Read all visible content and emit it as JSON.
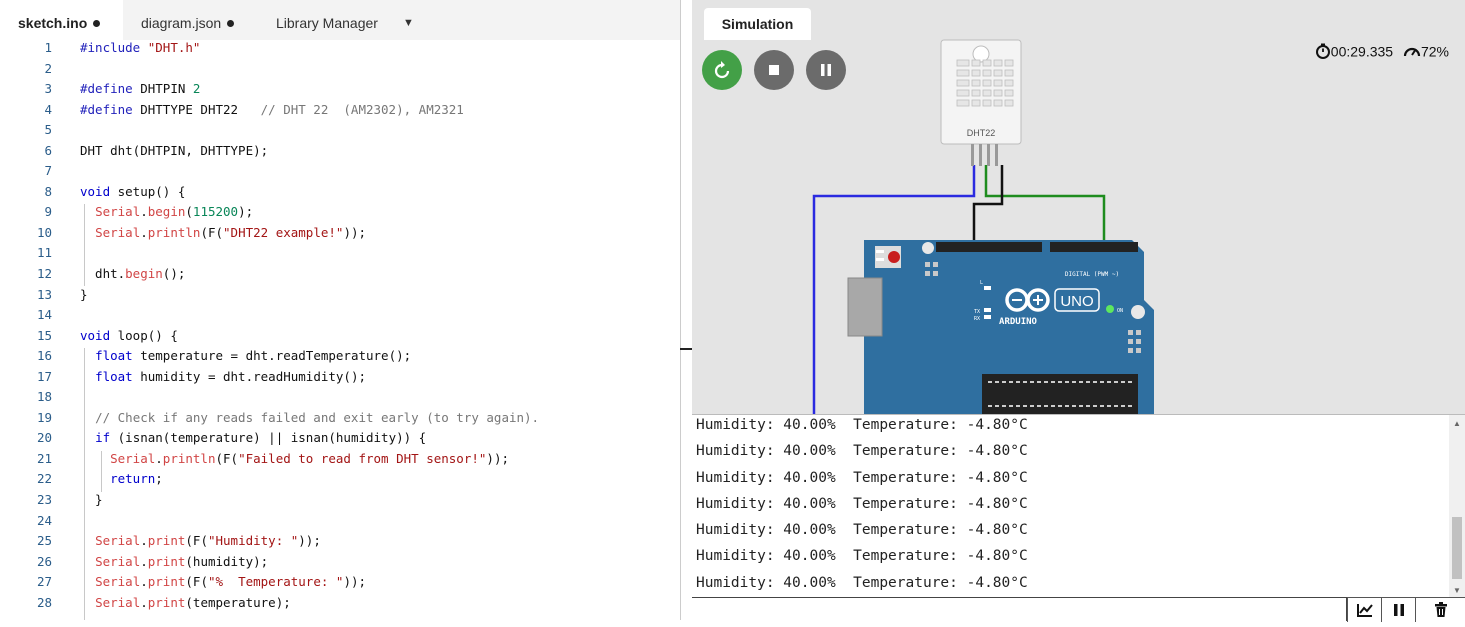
{
  "tabs": [
    {
      "label": "sketch.ino",
      "modified": true,
      "active": true
    },
    {
      "label": "diagram.json",
      "modified": true,
      "active": false
    },
    {
      "label": "Library Manager",
      "modified": false,
      "active": false
    }
  ],
  "code_lines": [
    {
      "n": "1",
      "text": "#include \"DHT.h\""
    },
    {
      "n": "2",
      "text": ""
    },
    {
      "n": "3",
      "text": "#define DHTPIN 2"
    },
    {
      "n": "4",
      "text": "#define DHTTYPE DHT22   // DHT 22  (AM2302), AM2321"
    },
    {
      "n": "5",
      "text": ""
    },
    {
      "n": "6",
      "text": "DHT dht(DHTPIN, DHTTYPE);"
    },
    {
      "n": "7",
      "text": ""
    },
    {
      "n": "8",
      "text": "void setup() {"
    },
    {
      "n": "9",
      "text": "  Serial.begin(115200);"
    },
    {
      "n": "10",
      "text": "  Serial.println(F(\"DHT22 example!\"));"
    },
    {
      "n": "11",
      "text": ""
    },
    {
      "n": "12",
      "text": "  dht.begin();"
    },
    {
      "n": "13",
      "text": "}"
    },
    {
      "n": "14",
      "text": ""
    },
    {
      "n": "15",
      "text": "void loop() {"
    },
    {
      "n": "16",
      "text": "  float temperature = dht.readTemperature();"
    },
    {
      "n": "17",
      "text": "  float humidity = dht.readHumidity();"
    },
    {
      "n": "18",
      "text": ""
    },
    {
      "n": "19",
      "text": "  // Check if any reads failed and exit early (to try again)."
    },
    {
      "n": "20",
      "text": "  if (isnan(temperature) || isnan(humidity)) {"
    },
    {
      "n": "21",
      "text": "    Serial.println(F(\"Failed to read from DHT sensor!\"));"
    },
    {
      "n": "22",
      "text": "    return;"
    },
    {
      "n": "23",
      "text": "  }"
    },
    {
      "n": "24",
      "text": ""
    },
    {
      "n": "25",
      "text": "  Serial.print(F(\"Humidity: \"));"
    },
    {
      "n": "26",
      "text": "  Serial.print(humidity);"
    },
    {
      "n": "27",
      "text": "  Serial.print(F(\"%  Temperature: \"));"
    },
    {
      "n": "28",
      "text": "  Serial.print(temperature);"
    }
  ],
  "simulation": {
    "tab_label": "Simulation",
    "timer": "00:29.335",
    "speed": "72%",
    "sensor_label": "DHT22",
    "board": {
      "logo_text": "UNO",
      "brand": "ARDUINO",
      "on_label": "ON",
      "digital_label": "DIGITAL (PWM ~)",
      "tx_label": "TX",
      "rx_label": "RX",
      "l_label": "L"
    }
  },
  "serial_monitor": {
    "lines": [
      "Humidity: 40.00%  Temperature: -4.80°C",
      "Humidity: 40.00%  Temperature: -4.80°C",
      "Humidity: 40.00%  Temperature: -4.80°C",
      "Humidity: 40.00%  Temperature: -4.80°C",
      "Humidity: 40.00%  Temperature: -4.80°C",
      "Humidity: 40.00%  Temperature: -4.80°C",
      "Humidity: 40.00%  Temperature: -4.80°C"
    ],
    "input_value": ""
  },
  "colors": {
    "restart": "#43a047",
    "control_gray": "#6b6b6b",
    "board_blue": "#2f6fa0",
    "wire_blue": "#2a2ae0",
    "wire_green": "#1e8c1e"
  }
}
